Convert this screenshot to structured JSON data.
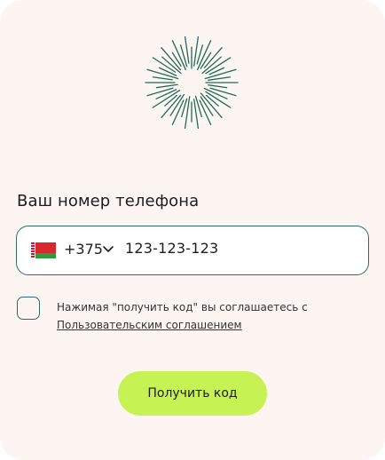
{
  "logo": {
    "icon": "sunburst-logo-icon",
    "color": "#1f6b5a"
  },
  "form": {
    "title": "Ваш номер телефона",
    "country_flag": "belarus-flag-icon",
    "country_code": "+375",
    "phone_value": "123-123-123",
    "consent_text": "Нажимая \"получить код\" вы соглашаетесь с",
    "consent_link": "Пользовательским соглашением",
    "checkbox_checked": false,
    "submit_label": "Получить код"
  },
  "colors": {
    "background": "#fdf5f2",
    "accent": "#2e6c62",
    "button": "#c6f254"
  }
}
